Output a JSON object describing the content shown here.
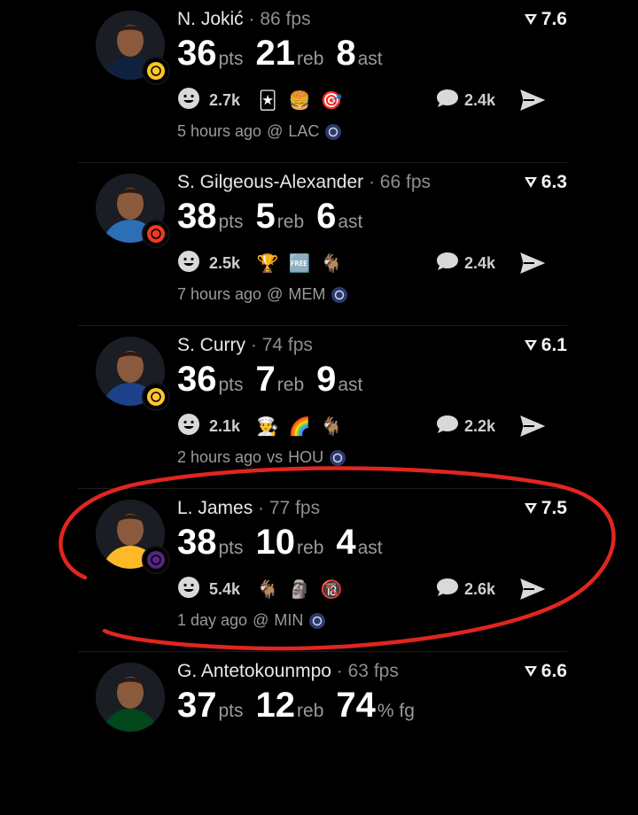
{
  "feed": [
    {
      "name": "N. Jokić",
      "fps": "86 fps",
      "rating": "7.6",
      "pts": "36",
      "pts_unit": "pts",
      "reb": "21",
      "reb_unit": "reb",
      "ast": "8",
      "ast_unit": "ast",
      "react_count": "2.7k",
      "comment_count": "2.4k",
      "emojis": [
        "🃏",
        "🍔",
        "🎯"
      ],
      "time": "5 hours ago",
      "loc": "@",
      "opp": "LAC",
      "avatar_color": "#0e2240",
      "jersey_color": "#0e2240",
      "team_logo_color": "#fec524"
    },
    {
      "name": "S. Gilgeous-Alexander",
      "fps": "66 fps",
      "rating": "6.3",
      "pts": "38",
      "pts_unit": "pts",
      "reb": "5",
      "reb_unit": "reb",
      "ast": "6",
      "ast_unit": "ast",
      "react_count": "2.5k",
      "comment_count": "2.4k",
      "emojis": [
        "🏆",
        "🆓",
        "🐐"
      ],
      "time": "7 hours ago",
      "loc": "@",
      "opp": "MEM",
      "avatar_color": "#1d3f7a",
      "jersey_color": "#2c6fb5",
      "team_logo_color": "#ef3b24"
    },
    {
      "name": "S. Curry",
      "fps": "74 fps",
      "rating": "6.1",
      "pts": "36",
      "pts_unit": "pts",
      "reb": "7",
      "reb_unit": "reb",
      "ast": "9",
      "ast_unit": "ast",
      "react_count": "2.1k",
      "comment_count": "2.2k",
      "emojis": [
        "👨‍🍳",
        "🌈",
        "🐐"
      ],
      "time": "2 hours ago",
      "loc": "vs",
      "opp": "HOU",
      "avatar_color": "#1d428a",
      "jersey_color": "#1d428a",
      "team_logo_color": "#ffc72c"
    },
    {
      "name": "L. James",
      "fps": "77 fps",
      "rating": "7.5",
      "pts": "38",
      "pts_unit": "pts",
      "reb": "10",
      "reb_unit": "reb",
      "ast": "4",
      "ast_unit": "ast",
      "react_count": "5.4k",
      "comment_count": "2.6k",
      "emojis": [
        "🐐",
        "🗿",
        "🔞"
      ],
      "time": "1 day ago",
      "loc": "@",
      "opp": "MIN",
      "avatar_color": "#552583",
      "jersey_color": "#fdb927",
      "team_logo_color": "#552583"
    },
    {
      "name": "G. Antetokounmpo",
      "fps": "63 fps",
      "rating": "6.6",
      "pts": "37",
      "pts_unit": "pts",
      "reb": "12",
      "reb_unit": "reb",
      "ast": "74",
      "ast_unit": "% fg",
      "avatar_color": "#00471b",
      "jersey_color": "#00471b"
    }
  ],
  "icons": {
    "rating": "upvote-arrow-icon",
    "react": "smiley-face-icon",
    "comment": "speech-bubble-icon",
    "share": "paper-plane-icon"
  },
  "colors": {
    "annotation": "#e0261f",
    "background": "#000000"
  }
}
